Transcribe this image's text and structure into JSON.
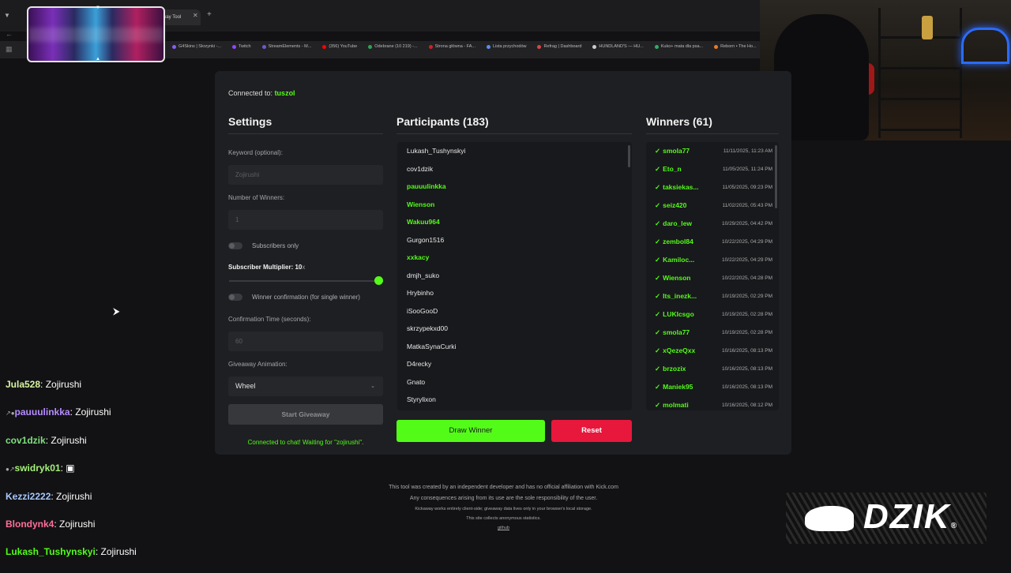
{
  "browser": {
    "active_tab_title": "way Tool",
    "bookmarks": [
      "G4Skins | Skrzynki -...",
      "Twitch",
      "StreamElements - M...",
      "(356) YouTube",
      "Odebrane (10 219) -...",
      "Strona główna - FA...",
      "Lista przychodów",
      "Refrag | Dashboard",
      "HUNDLAND'S — HU...",
      "Kuko+ mata dla psa...",
      "Reborn • The Ho..."
    ],
    "bookmark_colors": [
      "#8a5cf5",
      "#9146ff",
      "#6a5acd",
      "#ff0000",
      "#2ea44f",
      "#cc2222",
      "#5a8dee",
      "#d94646",
      "#cccccc",
      "#33aa66",
      "#e87a2c"
    ]
  },
  "app": {
    "connected_prefix": "Connected to:",
    "connected_channel": "tuszol",
    "settings": {
      "heading": "Settings",
      "keyword_label": "Keyword (optional):",
      "keyword_placeholder": "Zojirushi",
      "winners_label": "Number of Winners:",
      "winners_value": "1",
      "subscribers_only_label": "Subscribers only",
      "multiplier_label": "Subscriber Multiplier: 10",
      "multiplier_suffix": "x",
      "multiplier_level": 1.0,
      "winner_confirmation_label": "Winner confirmation (for single winner)",
      "confirmation_time_label": "Confirmation Time (seconds):",
      "confirmation_time_value": "60",
      "animation_label": "Giveaway Animation:",
      "animation_value": "Wheel",
      "start_button": "Start Giveaway",
      "status": "Connected to chat! Waiting for \"zojirushi\"."
    },
    "participants": {
      "heading": "Participants (183)",
      "rows": [
        {
          "name": "Lukash_Tushynskyi",
          "sub": false
        },
        {
          "name": "cov1dzik",
          "sub": false
        },
        {
          "name": "pauuulinkka",
          "sub": true
        },
        {
          "name": "Wienson",
          "sub": true
        },
        {
          "name": "Wakuu964",
          "sub": true
        },
        {
          "name": "Gurgon1516",
          "sub": false
        },
        {
          "name": "xxkacy",
          "sub": true
        },
        {
          "name": "dmjh_suko",
          "sub": false
        },
        {
          "name": "Hrybinho",
          "sub": false
        },
        {
          "name": "iSooGooD",
          "sub": false
        },
        {
          "name": "skrzypekxd00",
          "sub": false
        },
        {
          "name": "MatkaSynaCurki",
          "sub": false
        },
        {
          "name": "D4recky",
          "sub": false
        },
        {
          "name": "Gnato",
          "sub": false
        },
        {
          "name": "Styrylixon",
          "sub": false
        }
      ]
    },
    "winners": {
      "heading": "Winners (61)",
      "rows": [
        {
          "name": "smola77",
          "date": "11/11/2025, 11:23 AM"
        },
        {
          "name": "Eto_n",
          "date": "11/05/2025, 11:24 PM"
        },
        {
          "name": "taksiekas...",
          "date": "11/05/2025, 09:23 PM"
        },
        {
          "name": "seiz420",
          "date": "11/02/2025, 05:43 PM"
        },
        {
          "name": "daro_lew",
          "date": "10/29/2025, 04:42 PM"
        },
        {
          "name": "zembol84",
          "date": "10/22/2025, 04:29 PM"
        },
        {
          "name": "Kamiloc...",
          "date": "10/22/2025, 04:29 PM"
        },
        {
          "name": "Wienson",
          "date": "10/22/2025, 04:28 PM"
        },
        {
          "name": "Its_inezk...",
          "date": "10/19/2025, 02:29 PM"
        },
        {
          "name": "LUKIcsgo",
          "date": "10/19/2025, 02:28 PM"
        },
        {
          "name": "smola77",
          "date": "10/19/2025, 02:28 PM"
        },
        {
          "name": "xQezeQxx",
          "date": "10/16/2025, 08:13 PM"
        },
        {
          "name": "brzozix",
          "date": "10/16/2025, 08:13 PM"
        },
        {
          "name": "Maniek95",
          "date": "10/16/2025, 08:13 PM"
        },
        {
          "name": "molmati",
          "date": "10/16/2025, 08:12 PM"
        }
      ]
    },
    "draw_button": "Draw Winner",
    "reset_button": "Reset",
    "footer": {
      "line1": "This tool was created by an independent developer and has no official affiliation with Kick.com",
      "line2": "Any consequences arising from its use are the sole responsibility of the user.",
      "line3": "Kickaway works entirely client-side; giveaway data lives only in your browser's local storage.",
      "line4": "This site collects anonymous statistics.",
      "link": "github"
    }
  },
  "chat": [
    {
      "user": "Jula528",
      "text": "Zojirushi",
      "color": "#d8f5a2",
      "badges": ""
    },
    {
      "user": "pauuulinkka",
      "text": "Zojirushi",
      "color": "#b58cff",
      "badges": "↗●"
    },
    {
      "user": "cov1dzik",
      "text": "Zojirushi",
      "color": "#7fe07f",
      "badges": ""
    },
    {
      "user": "swidryk01",
      "text": "▣",
      "color": "#a6f07a",
      "badges": "●↗"
    },
    {
      "user": "Kezzi2222",
      "text": "Zojirushi",
      "color": "#a8c8ff",
      "badges": ""
    },
    {
      "user": "Blondynk4",
      "text": "Zojirushi",
      "color": "#ff6f9a",
      "badges": ""
    },
    {
      "user": "Lukash_Tushynskyi",
      "text": "Zojirushi",
      "color": "#53fc18",
      "badges": ""
    }
  ],
  "overlay": {
    "logo_text": "DZIK",
    "logo_reg": "®"
  },
  "colors": {
    "kick_green": "#53fc18",
    "reset_red": "#e8173c",
    "panel_bg": "#1e1f22"
  }
}
